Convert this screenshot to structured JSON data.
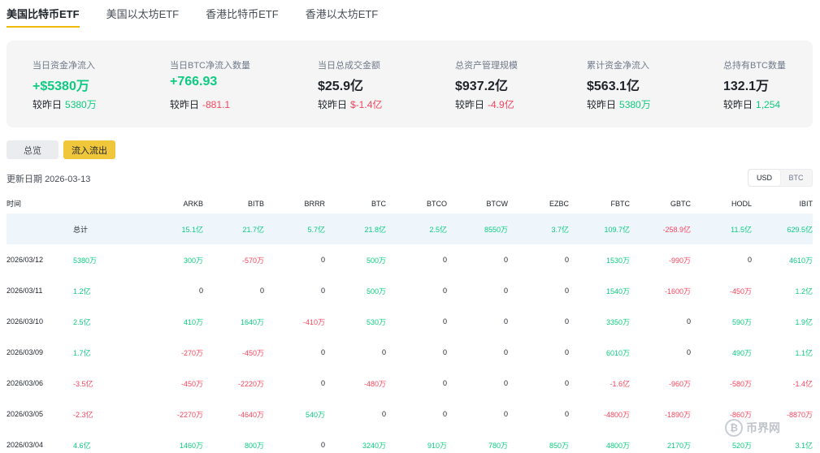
{
  "tabs": [
    {
      "label": "美国比特币ETF",
      "active": true
    },
    {
      "label": "美国以太坊ETF",
      "active": false
    },
    {
      "label": "香港比特币ETF",
      "active": false
    },
    {
      "label": "香港以太坊ETF",
      "active": false
    }
  ],
  "summary": [
    {
      "label": "当日资金净流入",
      "value": "+$5380万",
      "value_color": "green",
      "sub_prefix": "较昨日",
      "sub_value": "5380万",
      "sub_color": "green"
    },
    {
      "label": "当日BTC净流入数量",
      "value": "+766.93",
      "value_color": "green",
      "sub_prefix": "较昨日",
      "sub_value": "-881.1",
      "sub_color": "red"
    },
    {
      "label": "当日总成交金额",
      "value": "$25.9亿",
      "value_color": "default",
      "sub_prefix": "较昨日",
      "sub_value": "$-1.4亿",
      "sub_color": "red"
    },
    {
      "label": "总资产管理规模",
      "value": "$937.2亿",
      "value_color": "default",
      "sub_prefix": "较昨日",
      "sub_value": "-4.9亿",
      "sub_color": "red"
    },
    {
      "label": "累计资金净流入",
      "value": "$563.1亿",
      "value_color": "default",
      "sub_prefix": "较昨日",
      "sub_value": "5380万",
      "sub_color": "green"
    },
    {
      "label": "总持有BTC数量",
      "value": "132.1万",
      "value_color": "default",
      "sub_prefix": "较昨日",
      "sub_value": "1,254",
      "sub_color": "green"
    }
  ],
  "buttons": {
    "overview": "总览",
    "flow": "流入流出"
  },
  "update": {
    "label": "更新日期",
    "date": "2026-03-13"
  },
  "unit_toggle": [
    {
      "label": "USD",
      "active": true
    },
    {
      "label": "BTC",
      "active": false
    }
  ],
  "colors": {
    "green": "#0ecb81",
    "red": "#f6465d",
    "accent": "#f0b90b"
  },
  "table": {
    "headers": [
      "时间",
      "",
      "ARKB",
      "BITB",
      "BRRR",
      "BTC",
      "BTCO",
      "BTCW",
      "EZBC",
      "FBTC",
      "GBTC",
      "HODL",
      "IBIT"
    ],
    "total_label": "总计",
    "total": [
      "15.1亿",
      "21.7亿",
      "5.7亿",
      "21.8亿",
      "2.5亿",
      "8550万",
      "3.7亿",
      "109.7亿",
      "-258.9亿",
      "11.5亿",
      "629.5亿"
    ],
    "rows": [
      {
        "date": "2026/03/12",
        "net": "5380万",
        "values": [
          "300万",
          "-570万",
          "0",
          "500万",
          "0",
          "0",
          "0",
          "1530万",
          "-990万",
          "0",
          "4610万"
        ]
      },
      {
        "date": "2026/03/11",
        "net": "1.2亿",
        "values": [
          "0",
          "0",
          "0",
          "500万",
          "0",
          "0",
          "0",
          "1540万",
          "-1600万",
          "-450万",
          "1.2亿"
        ]
      },
      {
        "date": "2026/03/10",
        "net": "2.5亿",
        "values": [
          "410万",
          "1640万",
          "-410万",
          "530万",
          "0",
          "0",
          "0",
          "3350万",
          "0",
          "590万",
          "1.9亿"
        ]
      },
      {
        "date": "2026/03/09",
        "net": "1.7亿",
        "values": [
          "-270万",
          "-450万",
          "0",
          "0",
          "0",
          "0",
          "0",
          "6010万",
          "0",
          "490万",
          "1.1亿"
        ]
      },
      {
        "date": "2026/03/06",
        "net": "-3.5亿",
        "values": [
          "-450万",
          "-2220万",
          "0",
          "-480万",
          "0",
          "0",
          "0",
          "-1.6亿",
          "-960万",
          "-580万",
          "-1.4亿"
        ]
      },
      {
        "date": "2026/03/05",
        "net": "-2.3亿",
        "values": [
          "-2270万",
          "-4640万",
          "540万",
          "0",
          "0",
          "0",
          "0",
          "-4800万",
          "-1890万",
          "-860万",
          "-8870万"
        ]
      },
      {
        "date": "2026/03/04",
        "net": "4.6亿",
        "values": [
          "1460万",
          "800万",
          "0",
          "3240万",
          "910万",
          "780万",
          "850万",
          "4800万",
          "2170万",
          "520万",
          "3.1亿"
        ]
      }
    ]
  },
  "watermark": {
    "icon": "bitcoin-coin-icon",
    "text": "币界网"
  }
}
